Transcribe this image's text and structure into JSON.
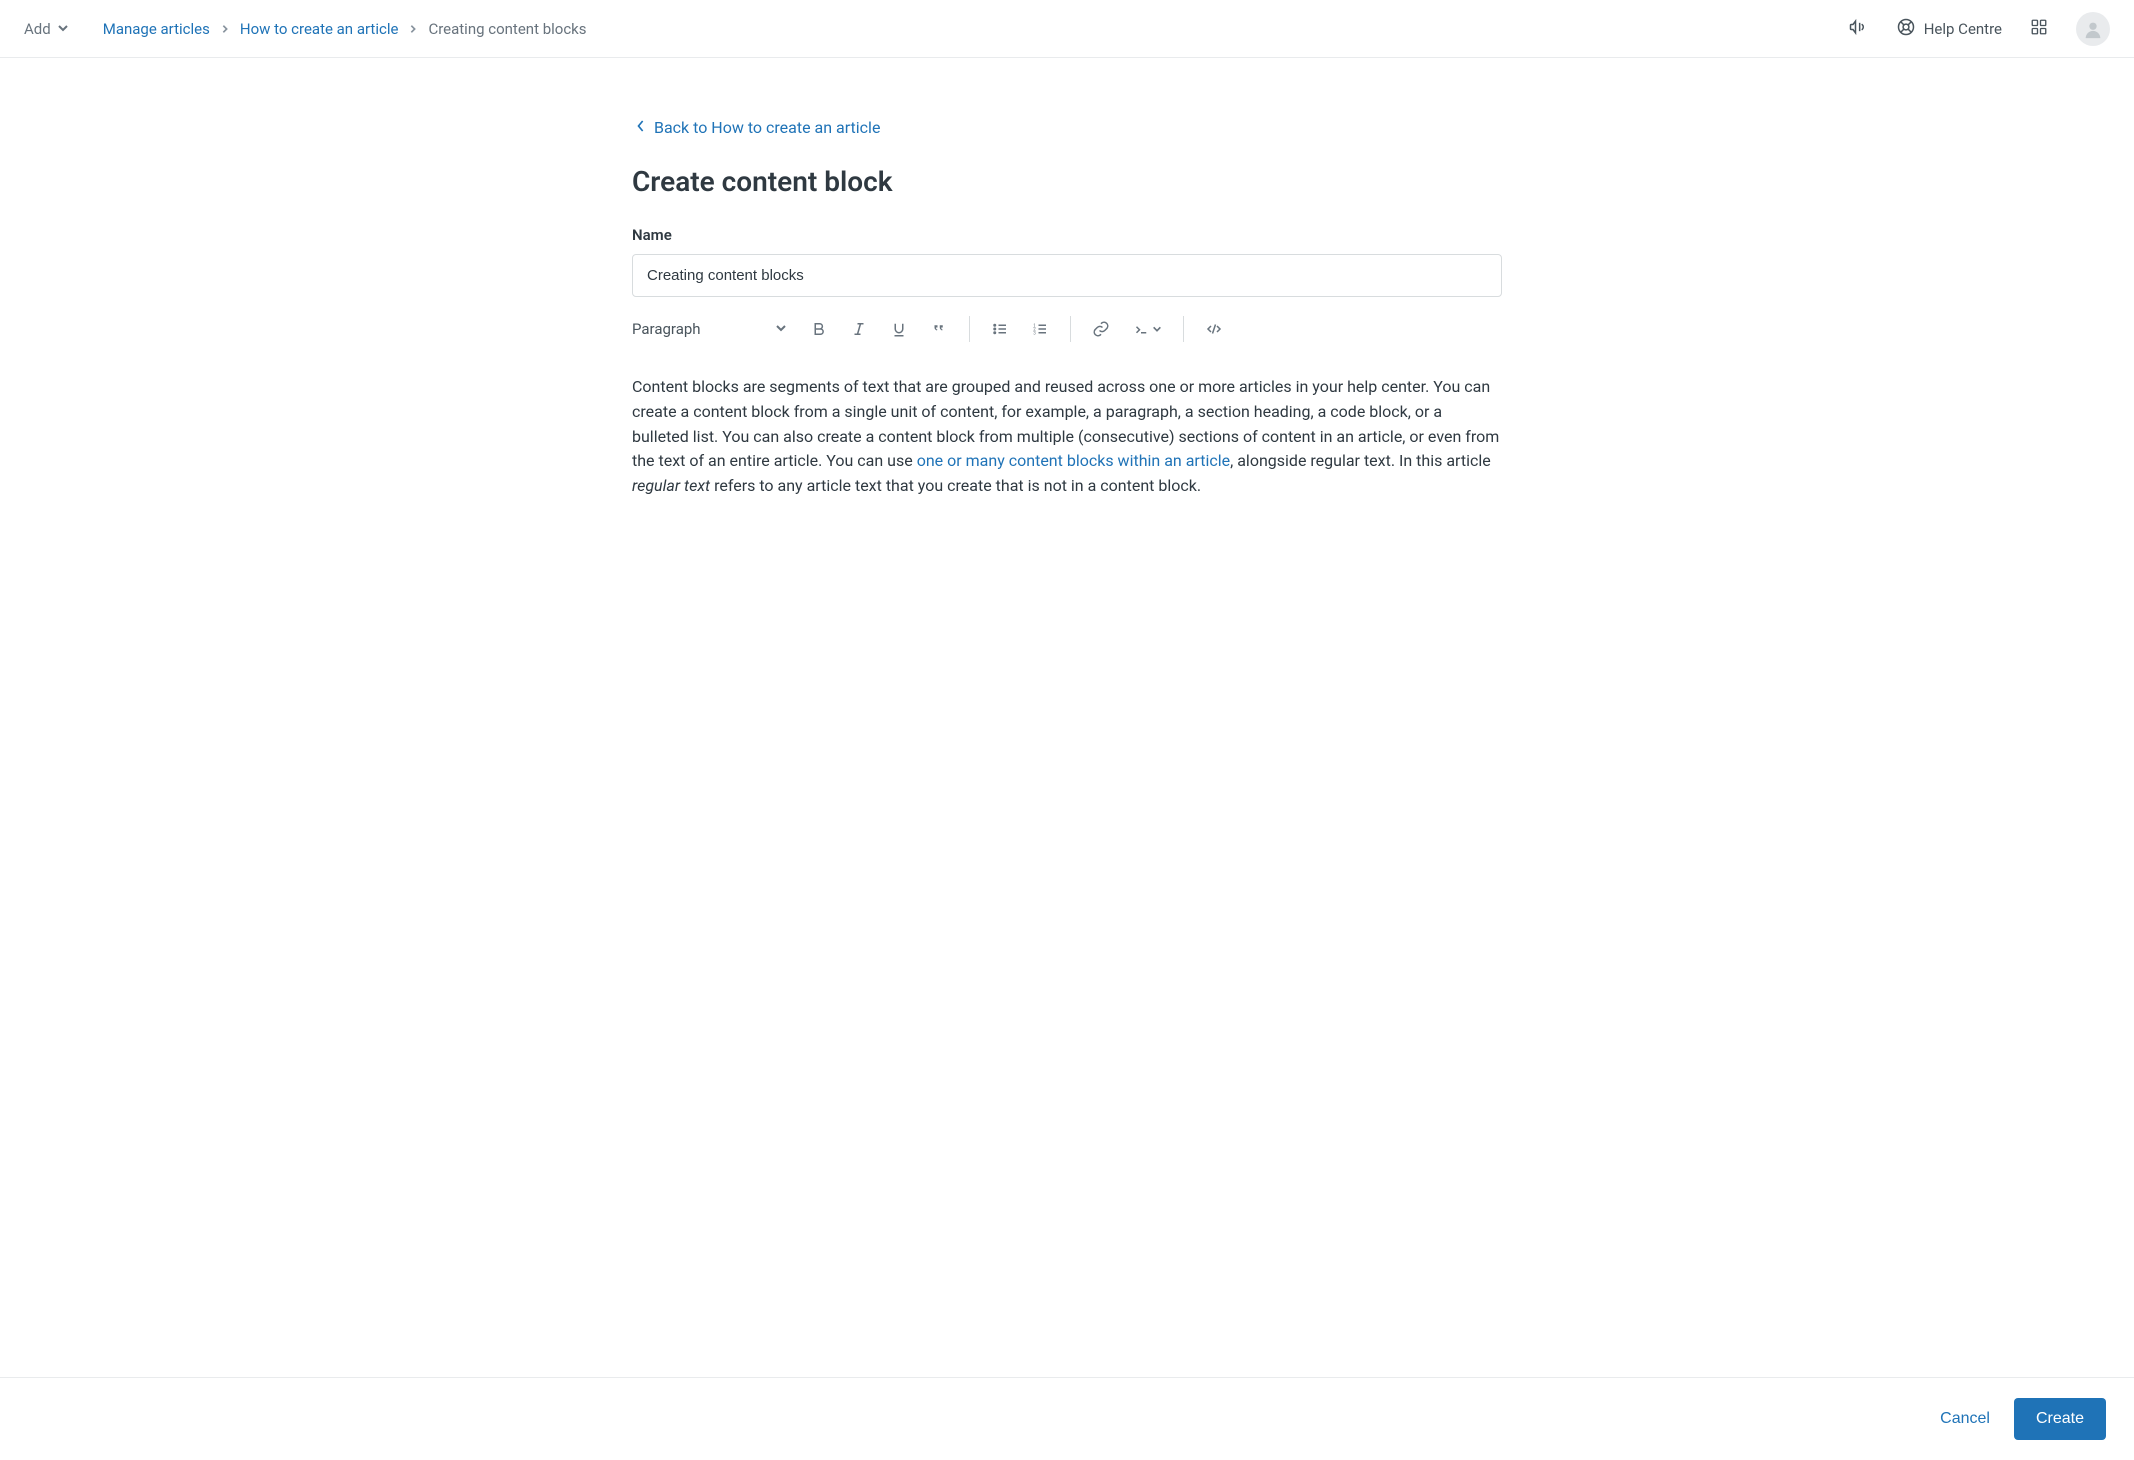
{
  "topbar": {
    "add_label": "Add",
    "breadcrumb": {
      "item1": "Manage articles",
      "item2": "How to create an article",
      "item3": "Creating content blocks"
    },
    "help_centre_label": "Help Centre"
  },
  "back_link": "Back to How to create an article",
  "page_title": "Create content block",
  "name_field": {
    "label": "Name",
    "value": "Creating content blocks"
  },
  "toolbar": {
    "format_label": "Paragraph"
  },
  "body": {
    "part1": "Content blocks are segments of text that are grouped and reused across one or more articles in your help center. You can create a content block from a single unit of content, for example, a paragraph, a section heading, a code block, or a bulleted list. You can also create a content block from multiple (consecutive) sections of content in an article, or even from the text of an entire article. You can use ",
    "link": "one or many content blocks within an article",
    "part2": ", alongside regular text. In this article ",
    "italic": "regular text",
    "part3": " refers to any article text that you create that is not in a content block."
  },
  "footer": {
    "cancel_label": "Cancel",
    "create_label": "Create"
  }
}
